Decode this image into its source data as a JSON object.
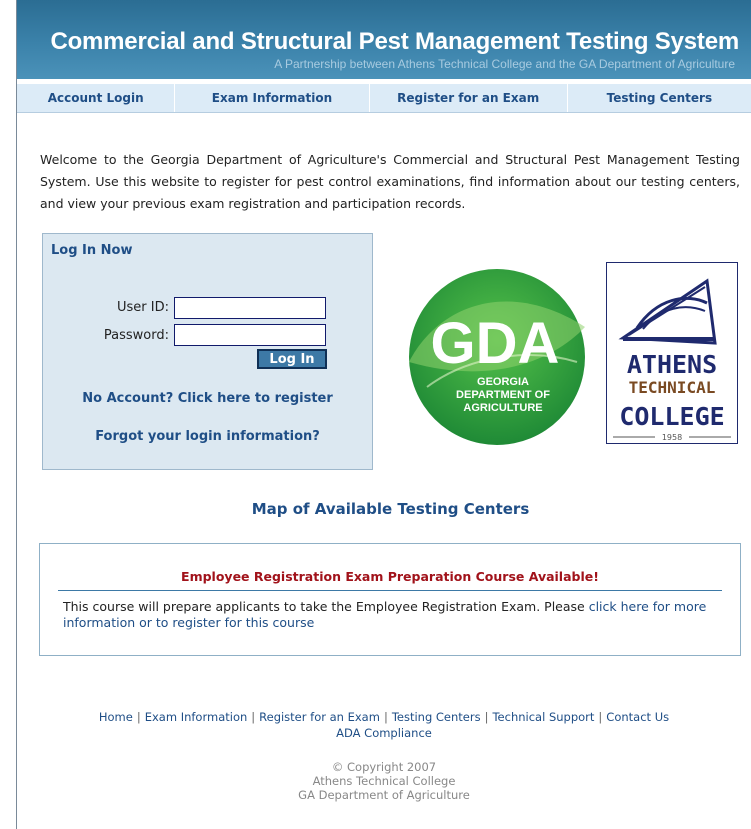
{
  "header": {
    "title": "Commercial and Structural Pest Management Testing System",
    "subtitle": "A Partnership between Athens Technical College and the GA Department of Agriculture"
  },
  "nav": [
    {
      "label": "Account Login"
    },
    {
      "label": "Exam Information"
    },
    {
      "label": "Register for an Exam"
    },
    {
      "label": "Testing Centers"
    }
  ],
  "welcome_text": "Welcome to the Georgia Department of Agriculture's Commercial and Structural Pest Management Testing System. Use this website to register for pest control examinations, find information about our testing centers, and view your previous exam registration and participation records.",
  "login": {
    "title": "Log In Now",
    "user_id_label": "User ID:",
    "password_label": "Password:",
    "user_id_value": "",
    "password_value": "",
    "button_label": "Log In",
    "register_link": "No Account? Click here to register",
    "forgot_link": "Forgot your login information?"
  },
  "logos": {
    "gda": {
      "big": "GDA",
      "line1": "GEORGIA",
      "line2": "DEPARTMENT OF",
      "line3": "AGRICULTURE"
    },
    "atc": {
      "line1": "ATHENS",
      "line2": "TECHNICAL",
      "line3": "COLLEGE",
      "year": "1958"
    }
  },
  "map_link": "Map of Available Testing Centers",
  "course": {
    "title": "Employee Registration Exam Preparation Course Available!",
    "text": "This course will prepare applicants to take the Employee Registration Exam. Please ",
    "link_text": "click here for more information or to register for this course"
  },
  "footer": {
    "links": [
      "Home",
      "Exam Information",
      "Register for an Exam",
      "Testing Centers",
      "Technical Support",
      "Contact Us"
    ],
    "ada": "ADA Compliance",
    "copyright": [
      "© Copyright 2007",
      "Athens Technical College",
      "GA Department of Agriculture"
    ]
  },
  "colors": {
    "banner": "#3b82aa",
    "nav_bg": "#dcebf7",
    "link": "#1f4e86",
    "alert": "#a1121a",
    "gda_green": "#2e9e3c",
    "atc_navy": "#1f2a6e",
    "atc_brown": "#7a4a22"
  }
}
